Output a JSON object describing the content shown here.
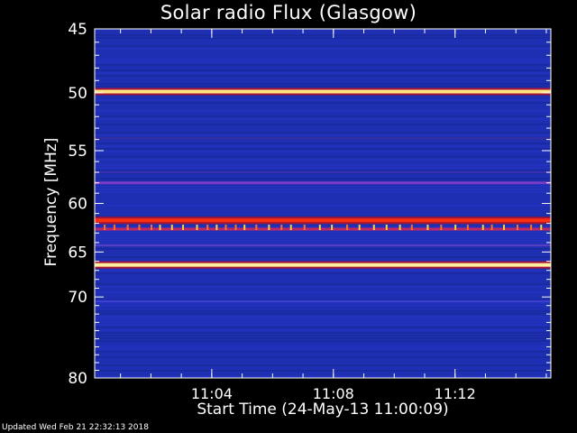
{
  "chart_data": {
    "type": "heatmap",
    "title": "Solar radio Flux (Glasgow)",
    "xlabel": "Start Time (24-May-13 11:00:09)",
    "ylabel": "Frequency [MHz]",
    "ylim": [
      45,
      80
    ],
    "xlim_minutes": [
      0.0,
      15.0
    ],
    "yticks": [
      45,
      50,
      55,
      60,
      65,
      70,
      80
    ],
    "xticks": [
      {
        "minute": 3.85,
        "label": "11:04"
      },
      {
        "minute": 7.85,
        "label": "11:08"
      },
      {
        "minute": 11.85,
        "label": "11:12"
      }
    ],
    "background_color": "#1e2fb0",
    "bands": [
      {
        "freq": 49.9,
        "intensity": "high",
        "color": "#ffe680"
      },
      {
        "freq": 53.9,
        "intensity": "low",
        "color": "#3a2da0"
      },
      {
        "freq": 57.0,
        "intensity": "low",
        "color": "#3b2fb5"
      },
      {
        "freq": 58.0,
        "intensity": "medium",
        "color": "#7a3cc8"
      },
      {
        "freq": 61.7,
        "intensity": "high",
        "color": "#ff3010"
      },
      {
        "freq": 62.6,
        "intensity": "medium",
        "color": "#c02860"
      },
      {
        "freq": 64.3,
        "intensity": "low",
        "color": "#5a40c0"
      },
      {
        "freq": 66.4,
        "intensity": "high",
        "color": "#fff0a0"
      },
      {
        "freq": 70.5,
        "intensity": "low",
        "color": "#4040d0"
      }
    ],
    "colors": {
      "high": "#ffe680",
      "medium": "#c02860",
      "low": "#3a2da0",
      "background": "#1e2fb0"
    }
  },
  "footer": "Updated Wed Feb 21 22:32:13 2018"
}
